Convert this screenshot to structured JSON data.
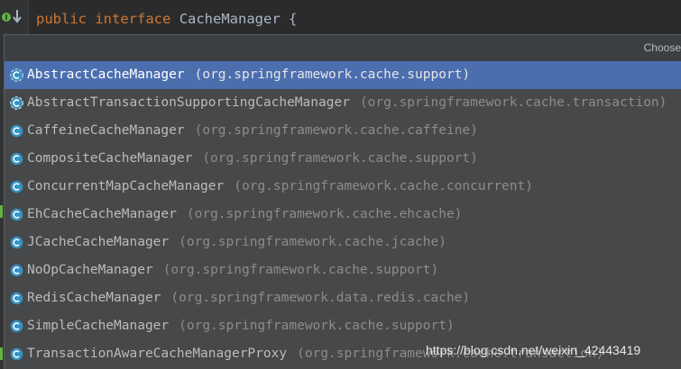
{
  "editor": {
    "code": {
      "keyword_public": "public",
      "keyword_interface": "interface",
      "class_name": "CacheManager",
      "brace": "{"
    }
  },
  "popup": {
    "hint": "Choose",
    "items": [
      {
        "name": "AbstractCacheManager",
        "pkg": "(org.springframework.cache.support)",
        "selected": true,
        "abstract": true
      },
      {
        "name": "AbstractTransactionSupportingCacheManager",
        "pkg": "(org.springframework.cache.transaction)",
        "selected": false,
        "abstract": true
      },
      {
        "name": "CaffeineCacheManager",
        "pkg": "(org.springframework.cache.caffeine)",
        "selected": false,
        "abstract": false
      },
      {
        "name": "CompositeCacheManager",
        "pkg": "(org.springframework.cache.support)",
        "selected": false,
        "abstract": false
      },
      {
        "name": "ConcurrentMapCacheManager",
        "pkg": "(org.springframework.cache.concurrent)",
        "selected": false,
        "abstract": false
      },
      {
        "name": "EhCacheCacheManager",
        "pkg": "(org.springframework.cache.ehcache)",
        "selected": false,
        "abstract": false
      },
      {
        "name": "JCacheCacheManager",
        "pkg": "(org.springframework.cache.jcache)",
        "selected": false,
        "abstract": false
      },
      {
        "name": "NoOpCacheManager",
        "pkg": "(org.springframework.cache.support)",
        "selected": false,
        "abstract": false
      },
      {
        "name": "RedisCacheManager",
        "pkg": "(org.springframework.data.redis.cache)",
        "selected": false,
        "abstract": false
      },
      {
        "name": "SimpleCacheManager",
        "pkg": "(org.springframework.cache.support)",
        "selected": false,
        "abstract": false
      },
      {
        "name": "TransactionAwareCacheManagerProxy",
        "pkg": "(org.springframework.cache.transaction)",
        "selected": false,
        "abstract": false
      }
    ]
  },
  "watermark": "https://blog.csdn.net/weixin_42443419",
  "colors": {
    "selection": "#4b6eaf",
    "class_icon": "#3592c4",
    "keyword": "#cc7832"
  }
}
